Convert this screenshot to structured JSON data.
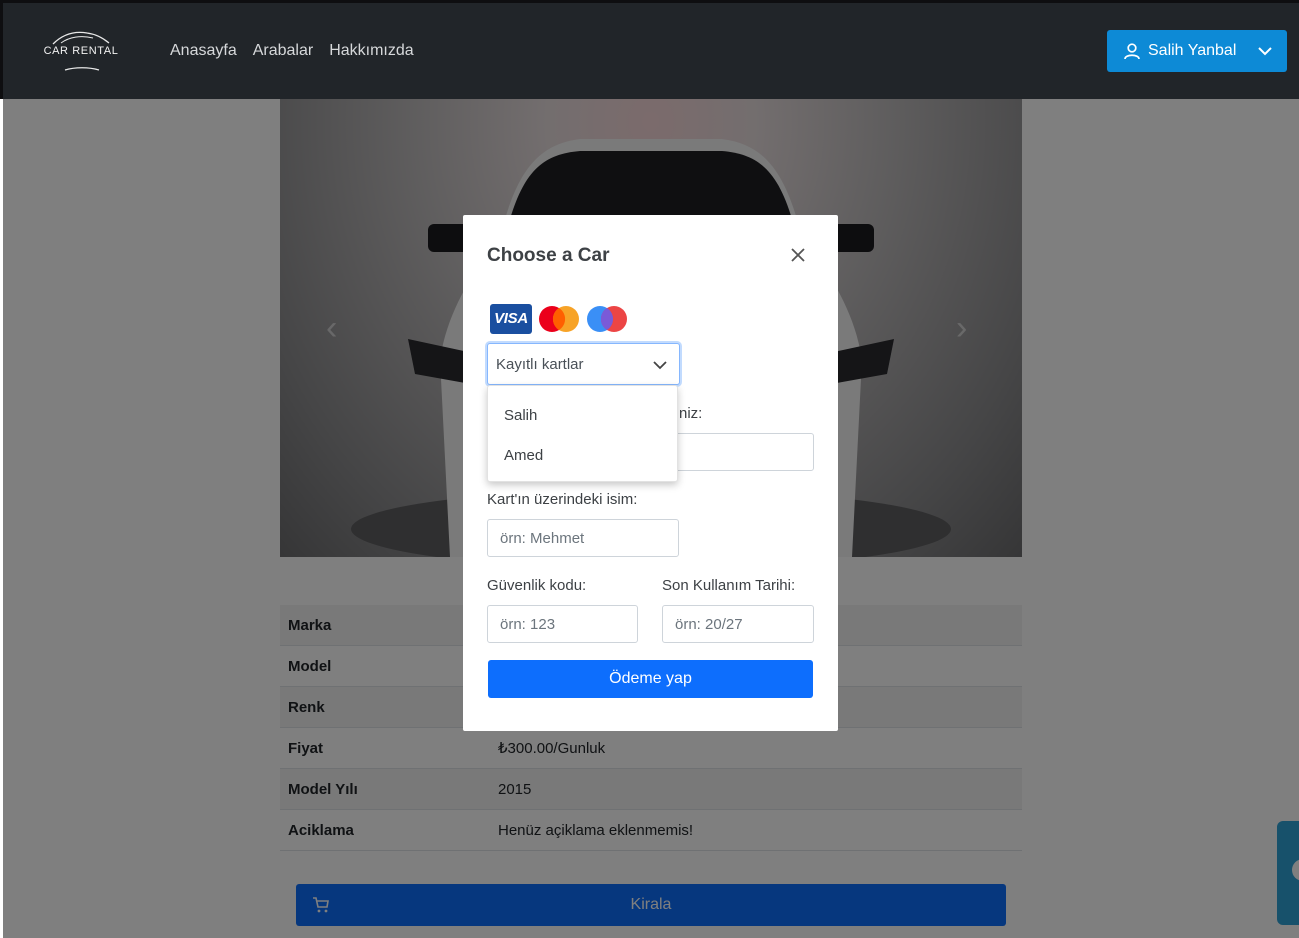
{
  "navbar": {
    "logo_text": "CAR RENTAL",
    "links": [
      "Anasayfa",
      "Arabalar",
      "Hakkımızda"
    ],
    "user_name": "Salih Yanbal"
  },
  "car_details": [
    {
      "label": "Marka",
      "value": ""
    },
    {
      "label": "Model",
      "value": ""
    },
    {
      "label": "Renk",
      "value": ""
    },
    {
      "label": "Fiyat",
      "value": "₺300.00/Gunluk"
    },
    {
      "label": "Model Yılı",
      "value": "2015"
    },
    {
      "label": "Aciklama",
      "value": "Henüz açiklama eklenmemis!"
    }
  ],
  "rent_button_label": "Kirala",
  "modal": {
    "title": "Choose a Car",
    "card_brands": [
      "VISA",
      "mastercard",
      "maestro"
    ],
    "saved_cards_select": {
      "value": "Kayıtlı kartlar",
      "options": [
        "Salih",
        "Amed"
      ]
    },
    "card_number_label_fragment": "niz:",
    "card_name_label": "Kart'ın üzerindeki isim:",
    "card_name_placeholder": "örn: Mehmet",
    "cvv_label": "Güvenlik kodu:",
    "cvv_placeholder": "örn: 123",
    "expiry_label": "Son Kullanım Tarihi:",
    "expiry_placeholder": "örn: 20/27",
    "pay_button_label": "Ödeme yap"
  },
  "colors": {
    "navbar_bg": "#212529",
    "user_button_bg": "#0d8ad6",
    "primary": "#0d6efd"
  }
}
